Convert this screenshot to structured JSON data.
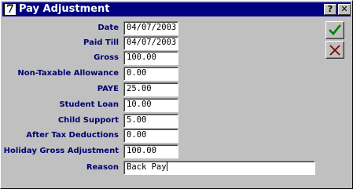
{
  "window": {
    "title": "Pay Adjustment",
    "app_icon_glyph": "7",
    "help_button_label": "?",
    "close_button_label": "✕"
  },
  "form": {
    "fields": [
      {
        "label": "Date",
        "value": "04/07/2003"
      },
      {
        "label": "Paid Till",
        "value": "04/07/2003"
      },
      {
        "label": "Gross",
        "value": "100.00"
      },
      {
        "label": "Non-Taxable Allowance",
        "value": "0.00"
      },
      {
        "label": "PAYE",
        "value": "25.00"
      },
      {
        "label": "Student Loan",
        "value": "10.00"
      },
      {
        "label": "Child Support",
        "value": "5.00"
      },
      {
        "label": "After Tax Deductions",
        "value": "0.00"
      },
      {
        "label": "Holiday Gross Adjustment",
        "value": "100.00"
      },
      {
        "label": "Reason",
        "value": "Back Pay"
      }
    ]
  },
  "actions": {
    "ok_icon": "checkmark-icon",
    "cancel_icon": "cross-icon",
    "ok_color": "#008000",
    "cancel_color": "#800000"
  }
}
